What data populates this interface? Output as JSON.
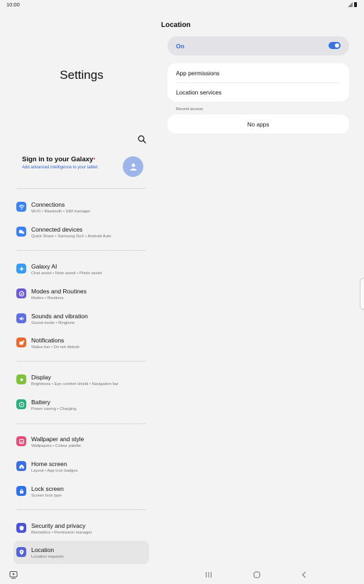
{
  "status_bar": {
    "time": "10:00"
  },
  "sidebar": {
    "title": "Settings",
    "account": {
      "title": "Sign in to your Galaxy",
      "badge_dot": "•",
      "subtitle": "Add advanced intelligence to your tablet."
    },
    "items": [
      {
        "label": "Connections",
        "sub": "Wi-Fi  •  Bluetooth  •  SIM manager",
        "icon": "wifi-icon",
        "color": "#3b82f0"
      },
      {
        "label": "Connected devices",
        "sub": "Quick Share  •  Samsung DeX  •  Android Auto",
        "icon": "connected-devices-icon",
        "color": "#3b82f0"
      },
      {
        "label": "Galaxy AI",
        "sub": "Chat assist  •  Note assist  •  Photo assist",
        "icon": "galaxy-ai-icon",
        "color": "#3a9cf2"
      },
      {
        "label": "Modes and Routines",
        "sub": "Modes  •  Routines",
        "icon": "modes-icon",
        "color": "#6a5ad6"
      },
      {
        "label": "Sounds and vibration",
        "sub": "Sound mode  •  Ringtone",
        "icon": "sound-icon",
        "color": "#5f6ee0"
      },
      {
        "label": "Notifications",
        "sub": "Status bar  •  Do not disturb",
        "icon": "notification-icon",
        "color": "#ea6a2e"
      },
      {
        "label": "Display",
        "sub": "Brightness  •  Eye comfort shield  •  Navigation bar",
        "icon": "display-icon",
        "color": "#7fc23d"
      },
      {
        "label": "Battery",
        "sub": "Power saving  •  Charging",
        "icon": "battery-icon",
        "color": "#2bae7e"
      },
      {
        "label": "Wallpaper and style",
        "sub": "Wallpapers  •  Colour palette",
        "icon": "wallpaper-icon",
        "color": "#e0507a"
      },
      {
        "label": "Home screen",
        "sub": "Layout  •  App icon badges",
        "icon": "home-icon",
        "color": "#3b6fe0"
      },
      {
        "label": "Lock screen",
        "sub": "Screen lock type",
        "icon": "lock-icon",
        "color": "#2f6fe8"
      },
      {
        "label": "Security and privacy",
        "sub": "Biometrics  •  Permission manager",
        "icon": "shield-icon",
        "color": "#4b55d4"
      },
      {
        "label": "Location",
        "sub": "Location requests",
        "icon": "location-icon",
        "color": "#5463d6"
      }
    ]
  },
  "location_panel": {
    "title": "Location",
    "toggle_label": "On",
    "toggle_on": true,
    "rows": [
      "App permissions",
      "Location services"
    ],
    "recent_access_label": "Recent access",
    "recent_access_empty": "No apps"
  }
}
